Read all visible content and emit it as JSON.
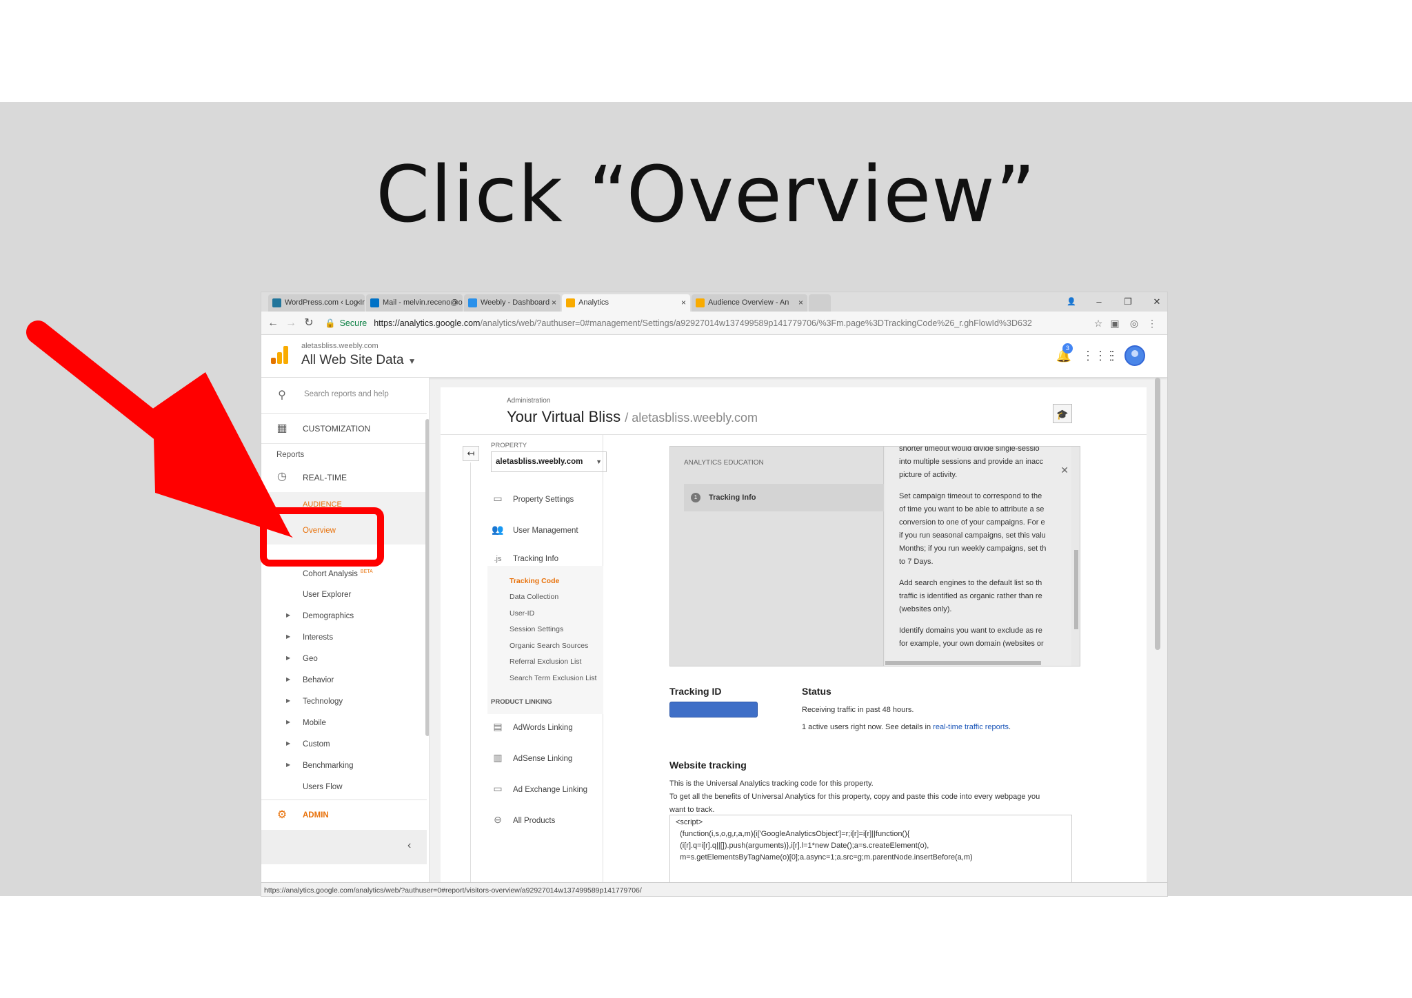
{
  "slide": {
    "title": "Click “Overview”"
  },
  "browser": {
    "tabs": [
      {
        "label": "WordPress.com ‹ Log In",
        "color": "#21759b"
      },
      {
        "label": "Mail - melvin.receno@o",
        "color": "#0072c6"
      },
      {
        "label": "Weebly - Dashboard",
        "color": "#2990ea"
      },
      {
        "label": "Analytics",
        "color": "#f9ab00"
      },
      {
        "label": "Audience Overview - An",
        "color": "#f9ab00"
      }
    ],
    "close_glyph": "×",
    "secure_label": "Secure",
    "url_host": "https://analytics.google.com",
    "url_path": "/analytics/web/?authuser=0#management/Settings/a92927014w137499589p141779706/%3Fm.page%3DTrackingCode%26_r.ghFlowId%3D632",
    "status_url": "https://analytics.google.com/analytics/web/?authuser=0#report/visitors-overview/a92927014w137499589p141779706/"
  },
  "header": {
    "account": "aletasbliss.weebly.com",
    "property": "All Web Site Data",
    "notification_count": "3"
  },
  "leftnav": {
    "search_placeholder": "Search reports and help",
    "customization": "CUSTOMIZATION",
    "reports": "Reports",
    "realtime": "REAL-TIME",
    "audience": "AUDIENCE",
    "overview": "Overview",
    "cohort": "Cohort Analysis",
    "beta": "BETA",
    "items": [
      "User Explorer",
      "Demographics",
      "Interests",
      "Geo",
      "Behavior",
      "Technology",
      "Mobile",
      "Custom",
      "Benchmarking",
      "Users Flow"
    ],
    "admin": "ADMIN"
  },
  "admin": {
    "label": "Administration",
    "title": "Your Virtual Bliss",
    "subtitle": "/ aletasbliss.weebly.com",
    "property_label": "PROPERTY",
    "property_value": "aletasbliss.weebly.com",
    "property_settings": "Property Settings",
    "user_management": "User Management",
    "tracking_info": "Tracking Info",
    "tracking_subitems": [
      "Tracking Code",
      "Data Collection",
      "User-ID",
      "Session Settings",
      "Organic Search Sources",
      "Referral Exclusion List",
      "Search Term Exclusion List"
    ],
    "product_linking": "PRODUCT LINKING",
    "links": [
      "AdWords Linking",
      "AdSense Linking",
      "Ad Exchange Linking",
      "All Products"
    ]
  },
  "education": {
    "heading": "ANALYTICS EDUCATION",
    "item_num": "1",
    "item": "Tracking Info",
    "para1": [
      "shorter timeout would divide single-sessio",
      "into multiple sessions and provide an inacc",
      "picture of activity."
    ],
    "para2": [
      "Set campaign timeout to correspond to the",
      "of time you want to be able to attribute a se",
      "conversion to one of your campaigns. For e",
      "if you run seasonal campaigns, set this valu",
      "Months; if you run weekly campaigns, set th",
      "to 7 Days."
    ],
    "para3": [
      "Add search engines to the default list so th",
      "traffic is identified as organic rather than re",
      "(websites only)."
    ],
    "para4": [
      "Identify domains you want to exclude as re",
      "for example, your own domain (websites or"
    ]
  },
  "tracking": {
    "id_label": "Tracking ID",
    "status_label": "Status",
    "status_line1": "Receiving traffic in past 48 hours.",
    "status_line2": "1 active users right now. See details in",
    "status_link": "real-time traffic reports",
    "status_end": ".",
    "wt_title": "Website tracking",
    "wt_line1": "This is the Universal Analytics tracking code for this property.",
    "wt_line2": "To get all the benefits of Universal Analytics for this property, copy and paste this code into every webpage you",
    "wt_line3": "want to track.",
    "code": "<script>\n  (function(i,s,o,g,r,a,m){i['GoogleAnalyticsObject']=r;i[r]=i[r]||function(){\n  (i[r].q=i[r].q||[]).push(arguments)},i[r].l=1*new Date();a=s.createElement(o),\n  m=s.getElementsByTagName(o)[0];a.async=1;a.src=g;m.parentNode.insertBefore(a,m)"
  },
  "colors": {
    "accent": "#e8710a",
    "annotation": "#ff0000",
    "link": "#1a55b8"
  }
}
